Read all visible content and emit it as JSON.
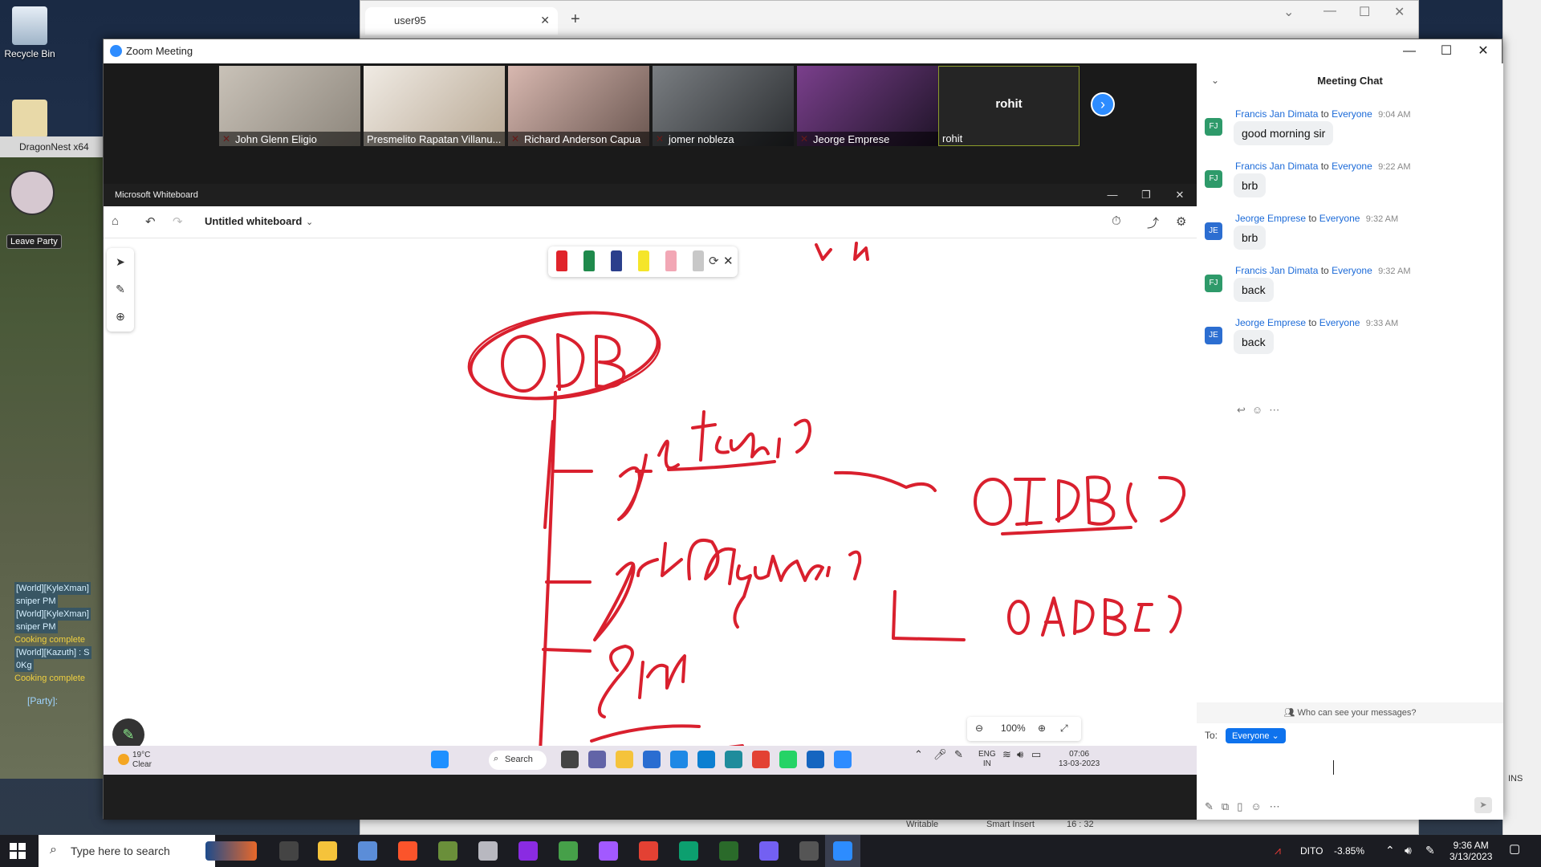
{
  "desktop": {
    "icons": [
      {
        "label": "Recycle Bin"
      }
    ]
  },
  "game": {
    "title": "DragonNest x64",
    "leave_party": "Leave Party",
    "chat_lines": [
      {
        "text": "[World][KyleXman]",
        "kind": "world"
      },
      {
        "text": "sniper PM",
        "kind": "world"
      },
      {
        "text": "[World][KyleXman]",
        "kind": "world"
      },
      {
        "text": "sniper PM",
        "kind": "world"
      },
      {
        "text": "Cooking complete",
        "kind": "cook"
      },
      {
        "text": "[World][Kazuth] : S",
        "kind": "world"
      },
      {
        "text": "0Kg",
        "kind": "world"
      },
      {
        "text": "Cooking complete",
        "kind": "cook"
      }
    ],
    "party_label": "[Party]:"
  },
  "background_window": {
    "tab_label": "user95",
    "status_items": [
      "Writable",
      "Smart Insert",
      "16 : 32"
    ],
    "side_text": "INS"
  },
  "zoom": {
    "title": "Zoom Meeting",
    "participants": [
      {
        "name": "John Glenn Eligio",
        "muted": true,
        "color": "#b9b2a8"
      },
      {
        "name": "Presmelito Rapatan Villanu...",
        "muted": false,
        "color": "#d9cfc4"
      },
      {
        "name": "Richard Anderson Capua",
        "muted": true,
        "color": "#a99187"
      },
      {
        "name": "jomer nobleza",
        "muted": true,
        "color": "#5f6468"
      },
      {
        "name": "Jeorge Emprese",
        "muted": true,
        "color": "#4a2f5a"
      },
      {
        "name": "rohit",
        "muted": false,
        "color": "#252525",
        "no_video": true
      }
    ],
    "next_icon": "chevron-right-icon"
  },
  "whiteboard": {
    "app_title": "Microsoft Whiteboard",
    "board_name": "Untitled whiteboard",
    "zoom_level": "100%",
    "pens": [
      {
        "color": "#e0242b",
        "name": "red-pen"
      },
      {
        "color": "#1f8a4c",
        "name": "green-pen"
      },
      {
        "color": "#2b3f8c",
        "name": "blue-pen"
      },
      {
        "color": "#f5e52a",
        "name": "highlighter"
      },
      {
        "color": "#f2a7b5",
        "name": "eraser"
      },
      {
        "color": "#c8c8c8",
        "name": "ruler"
      }
    ],
    "ink_color": "#d9202e"
  },
  "inner_taskbar": {
    "temp": "19°C",
    "condition": "Clear",
    "search_label": "Search",
    "lang": "ENG",
    "region": "IN",
    "time": "07:06",
    "date": "13-03-2023"
  },
  "chat": {
    "title": "Meeting Chat",
    "messages": [
      {
        "sender": "Francis Jan Dimata",
        "initials": "FJ",
        "to": "to",
        "recipient": "Everyone",
        "time": "9:04 AM",
        "text": "good morning sir",
        "avatar_color": "#2e9a6a"
      },
      {
        "sender": "Francis Jan Dimata",
        "initials": "FJ",
        "to": "to",
        "recipient": "Everyone",
        "time": "9:22 AM",
        "text": "brb",
        "avatar_color": "#2e9a6a"
      },
      {
        "sender": "Jeorge Emprese",
        "initials": "JE",
        "to": "to",
        "recipient": "Everyone",
        "time": "9:32 AM",
        "text": "brb",
        "avatar_color": "#2c6ed1"
      },
      {
        "sender": "Francis Jan Dimata",
        "initials": "FJ",
        "to": "to",
        "recipient": "Everyone",
        "time": "9:32 AM",
        "text": "back",
        "avatar_color": "#2e9a6a"
      },
      {
        "sender": "Jeorge Emprese",
        "initials": "JE",
        "to": "to",
        "recipient": "Everyone",
        "time": "9:33 AM",
        "text": "back",
        "avatar_color": "#2c6ed1"
      }
    ],
    "who_can_see": "Who can see your messages?",
    "to_label": "To:",
    "recipient_select": "Everyone"
  },
  "taskbar": {
    "search_placeholder": "Type here to search",
    "network": "DITO",
    "stock_change": "-3.85%",
    "time": "9:36 AM",
    "date": "3/13/2023"
  }
}
